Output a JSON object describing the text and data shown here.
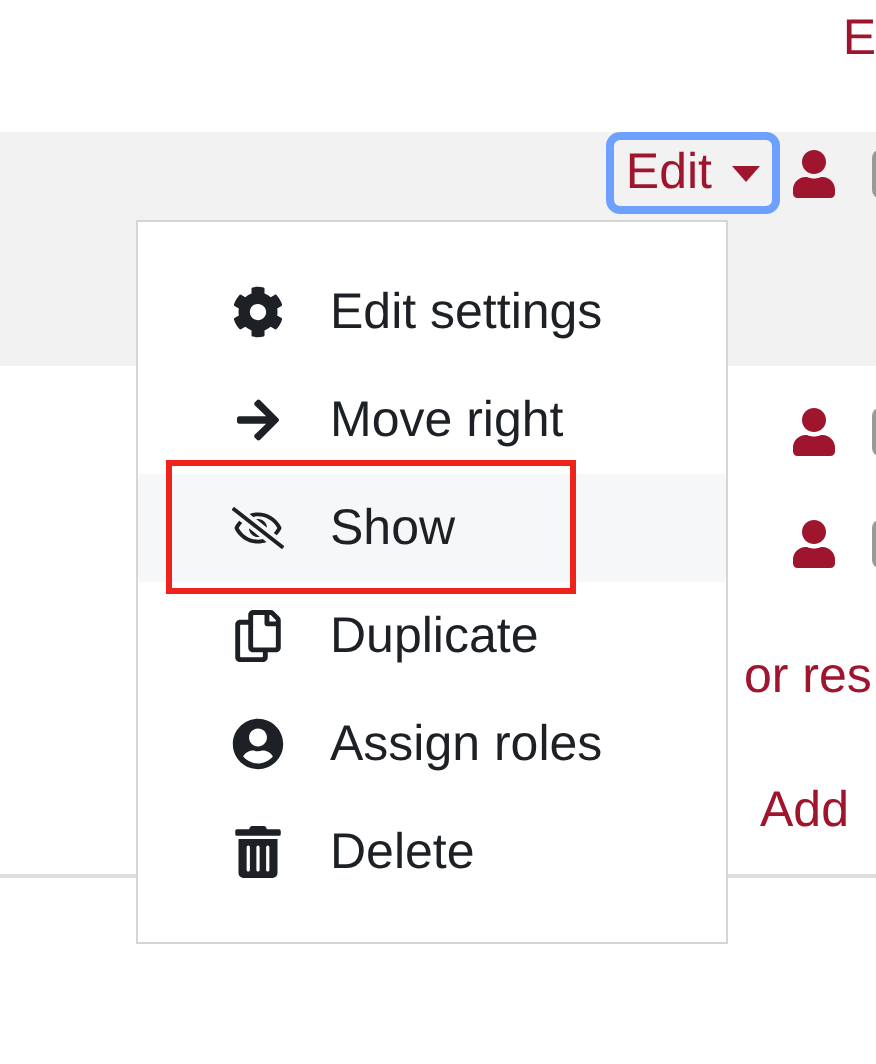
{
  "page": {
    "top_link": "E",
    "rows": [
      {
        "edit_button": {
          "label": "Edit",
          "focused": true
        },
        "checkbox": {
          "checked": false
        }
      },
      {
        "checkbox": {
          "checked": false
        }
      },
      {
        "checkbox": {
          "checked": false
        }
      },
      {
        "link": "or res"
      },
      {
        "link": "Add"
      }
    ]
  },
  "menu": {
    "items": [
      {
        "label": "Edit settings",
        "selected": false,
        "annotated": false
      },
      {
        "label": "Move right",
        "selected": false,
        "annotated": false
      },
      {
        "label": "Show",
        "selected": true,
        "annotated": true
      },
      {
        "label": "Duplicate",
        "selected": false,
        "annotated": false
      },
      {
        "label": "Assign roles",
        "selected": false,
        "annotated": false
      },
      {
        "label": "Delete",
        "selected": false,
        "annotated": false
      }
    ]
  }
}
